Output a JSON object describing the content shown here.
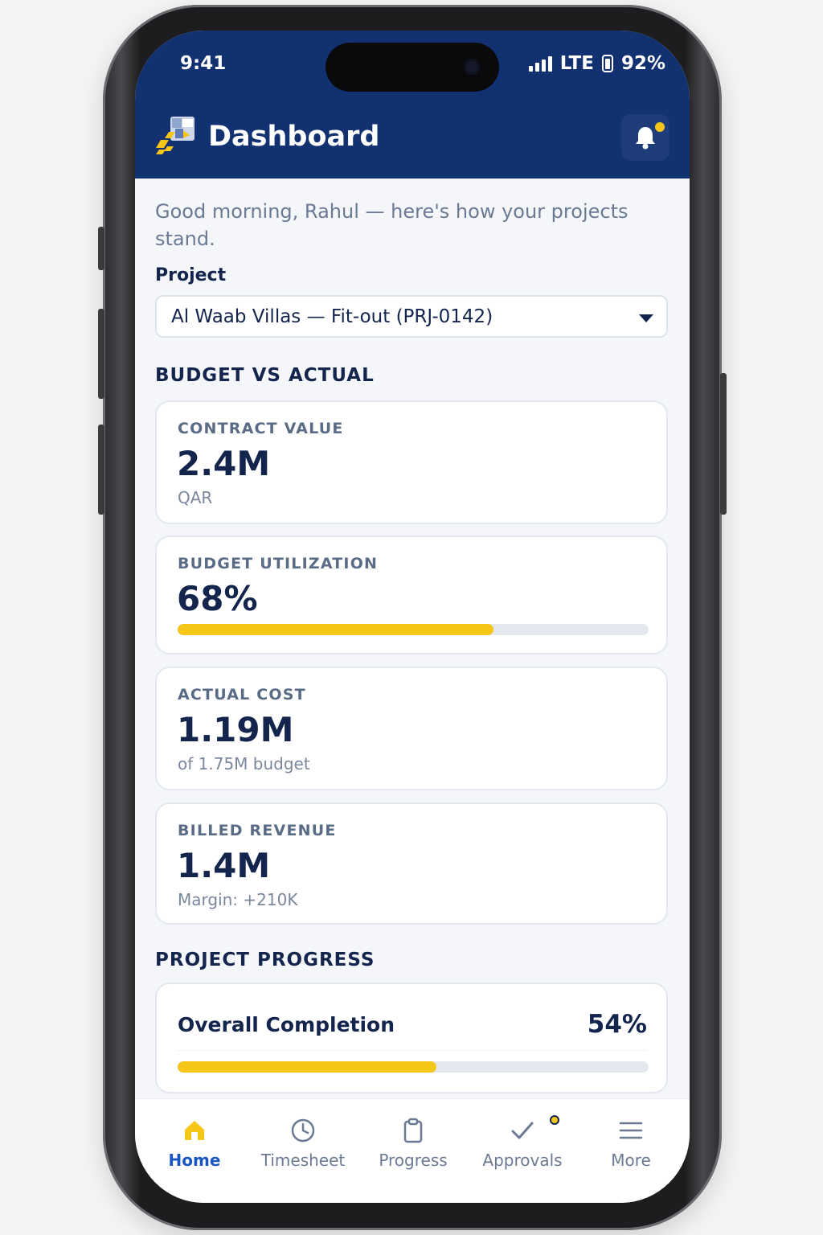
{
  "status_bar": {
    "time": "9:41",
    "network": "LTE",
    "battery": "92%"
  },
  "header": {
    "title": "Dashboard",
    "icons": {
      "logo": "construction-logo-icon",
      "notifications": "bell-icon"
    },
    "notification_badge": true
  },
  "greeting": "Good morning, Rahul — here's how your projects stand.",
  "project_selector": {
    "label": "Project",
    "selected": "Al Waab Villas — Fit-out (PRJ-0142)"
  },
  "budget_section": {
    "title": "BUDGET VS ACTUAL",
    "cards": [
      {
        "label": "CONTRACT VALUE",
        "value": "2.4M",
        "sub": "QAR"
      },
      {
        "label": "BUDGET UTILIZATION",
        "value": "68%",
        "progress": 0.67
      },
      {
        "label": "ACTUAL COST",
        "value": "1.19M",
        "sub": "of 1.75M budget"
      },
      {
        "label": "BILLED REVENUE",
        "value": "1.4M",
        "sub": "Margin: +210K"
      }
    ]
  },
  "progress_section": {
    "title": "PROJECT PROGRESS",
    "overall_label": "Overall Completion",
    "overall_value": "54%",
    "progress": 0.55
  },
  "tabs": [
    {
      "label": "Home",
      "icon": "home-icon",
      "active": true
    },
    {
      "label": "Timesheet",
      "icon": "clock-icon",
      "active": false
    },
    {
      "label": "Progress",
      "icon": "clipboard-icon",
      "active": false
    },
    {
      "label": "Approvals",
      "icon": "checkmark-icon",
      "active": false,
      "badge": true
    },
    {
      "label": "More",
      "icon": "menu-icon",
      "active": false
    }
  ],
  "colors": {
    "primary": "#123170",
    "accent": "#f5c518",
    "active_tab": "#1a55c4",
    "background": "#f4f6fa"
  }
}
